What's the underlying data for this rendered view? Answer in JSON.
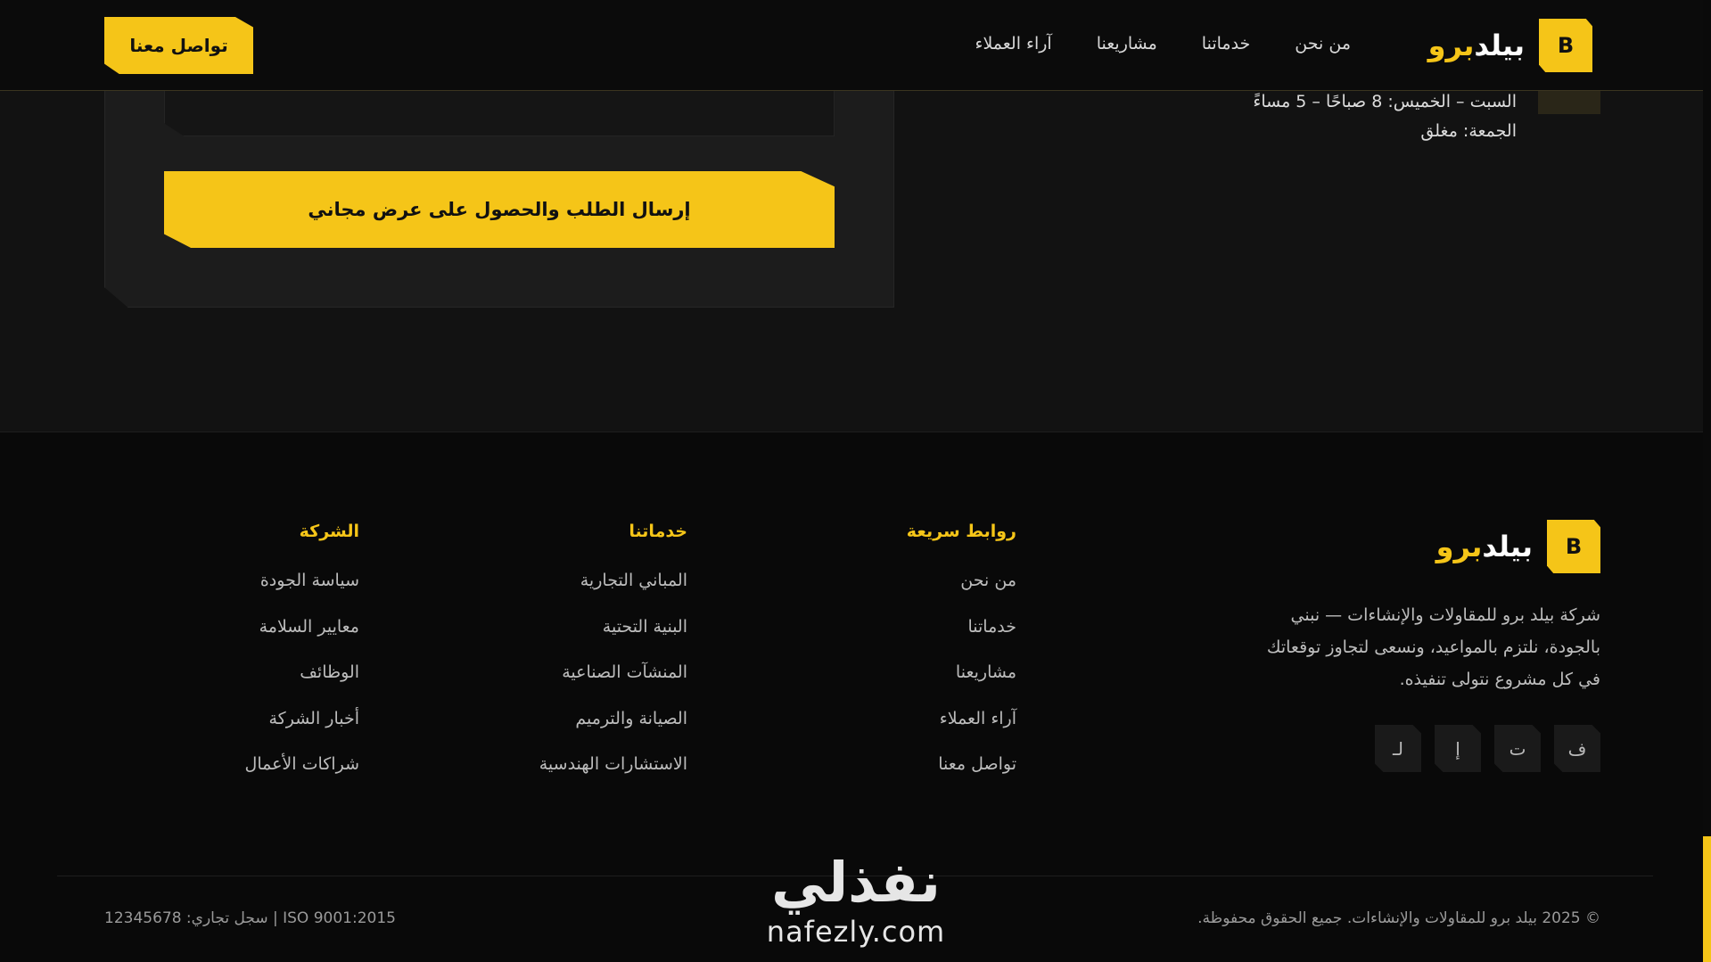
{
  "header": {
    "logo_letter": "B",
    "logo_white": "بيلد",
    "logo_yellow": "برو",
    "nav": [
      "من نحن",
      "خدماتنا",
      "مشاريعنا",
      "آراء العملاء"
    ],
    "cta": "تواصل معنا"
  },
  "form": {
    "submit": "إرسال الطلب والحصول على عرض مجاني"
  },
  "hours": {
    "line1": "السبت – الخميس: 8 صباحًا – 5 مساءً",
    "line2": "الجمعة: مغلق"
  },
  "footer": {
    "logo_letter": "B",
    "logo_white": "بيلد",
    "logo_yellow": "برو",
    "description": "شركة بيلد برو للمقاولات والإنشاءات — نبني بالجودة، نلتزم بالمواعيد، ونسعى لتجاوز توقعاتك في كل مشروع نتولى تنفيذه.",
    "socials": [
      "ف",
      "ت",
      "إ",
      "لـ"
    ],
    "columns": [
      {
        "title": "روابط سريعة",
        "items": [
          "من نحن",
          "خدماتنا",
          "مشاريعنا",
          "آراء العملاء",
          "تواصل معنا"
        ]
      },
      {
        "title": "خدماتنا",
        "items": [
          "المباني التجارية",
          "البنية التحتية",
          "المنشآت الصناعية",
          "الصيانة والترميم",
          "الاستشارات الهندسية"
        ]
      },
      {
        "title": "الشركة",
        "items": [
          "سياسة الجودة",
          "معايير السلامة",
          "الوظائف",
          "أخبار الشركة",
          "شراكات الأعمال"
        ]
      }
    ],
    "copyright": "© 2025 بيلد برو للمقاولات والإنشاءات. جميع الحقوق محفوظة.",
    "registration": "ISO 9001:2015 | سجل تجاري: 12345678"
  },
  "watermark": {
    "arabic": "نفذلي",
    "latin": "nafezly.com"
  },
  "colors": {
    "accent": "#f5c518",
    "background": "#121212",
    "footer": "#090909"
  }
}
